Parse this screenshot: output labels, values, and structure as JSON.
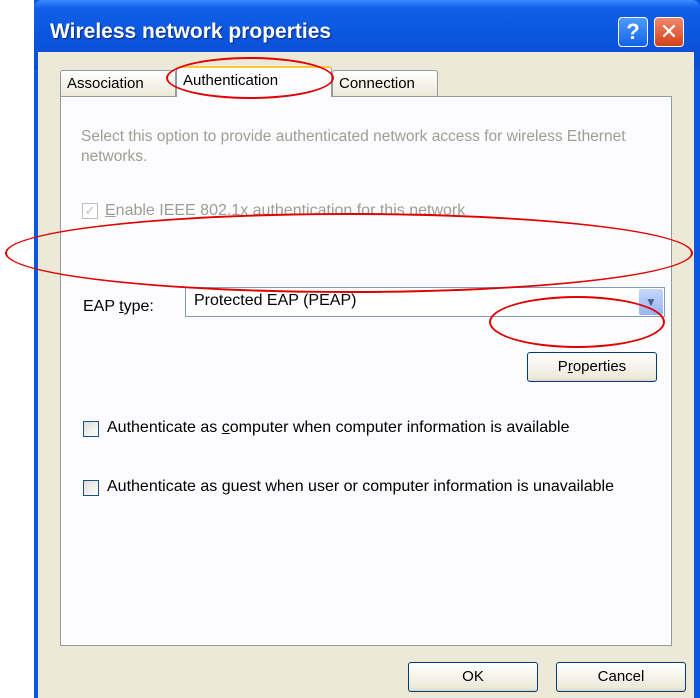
{
  "window": {
    "title": "Wireless network properties",
    "help_label": "?",
    "close_label": "✕"
  },
  "tabs": [
    {
      "label": "Association",
      "active": false
    },
    {
      "label": "Authentication",
      "active": true
    },
    {
      "label": "Connection",
      "active": false
    }
  ],
  "authentication": {
    "hint_text": "Select this option to provide authenticated network access for wireless Ethernet networks.",
    "enable_8021x": {
      "label_prefix": "",
      "label_mnemonic": "E",
      "label_rest": "nable IEEE 802.1x authentication for this network",
      "checked": true,
      "enabled": false
    },
    "eap_type": {
      "label_prefix": "EAP ",
      "label_mnemonic": "t",
      "label_rest": "ype:",
      "value": "Protected EAP (PEAP)"
    },
    "properties_button": {
      "prefix": "P",
      "mnemonic": "r",
      "rest": "operties"
    },
    "auth_as_computer": {
      "prefix": "Authenticate as ",
      "mnemonic": "c",
      "rest": "omputer when computer information is available",
      "checked": false
    },
    "auth_as_guest": {
      "prefix": "Authenticate as ",
      "mnemonic": "g",
      "rest": "uest when user or computer information is unavailable",
      "checked": false
    }
  },
  "footer": {
    "ok_label": "OK",
    "cancel_label": "Cancel"
  },
  "colors": {
    "titlebar": "#0a4fd2",
    "dialog_bg": "#ece9d8",
    "annotation": "#e00000"
  }
}
